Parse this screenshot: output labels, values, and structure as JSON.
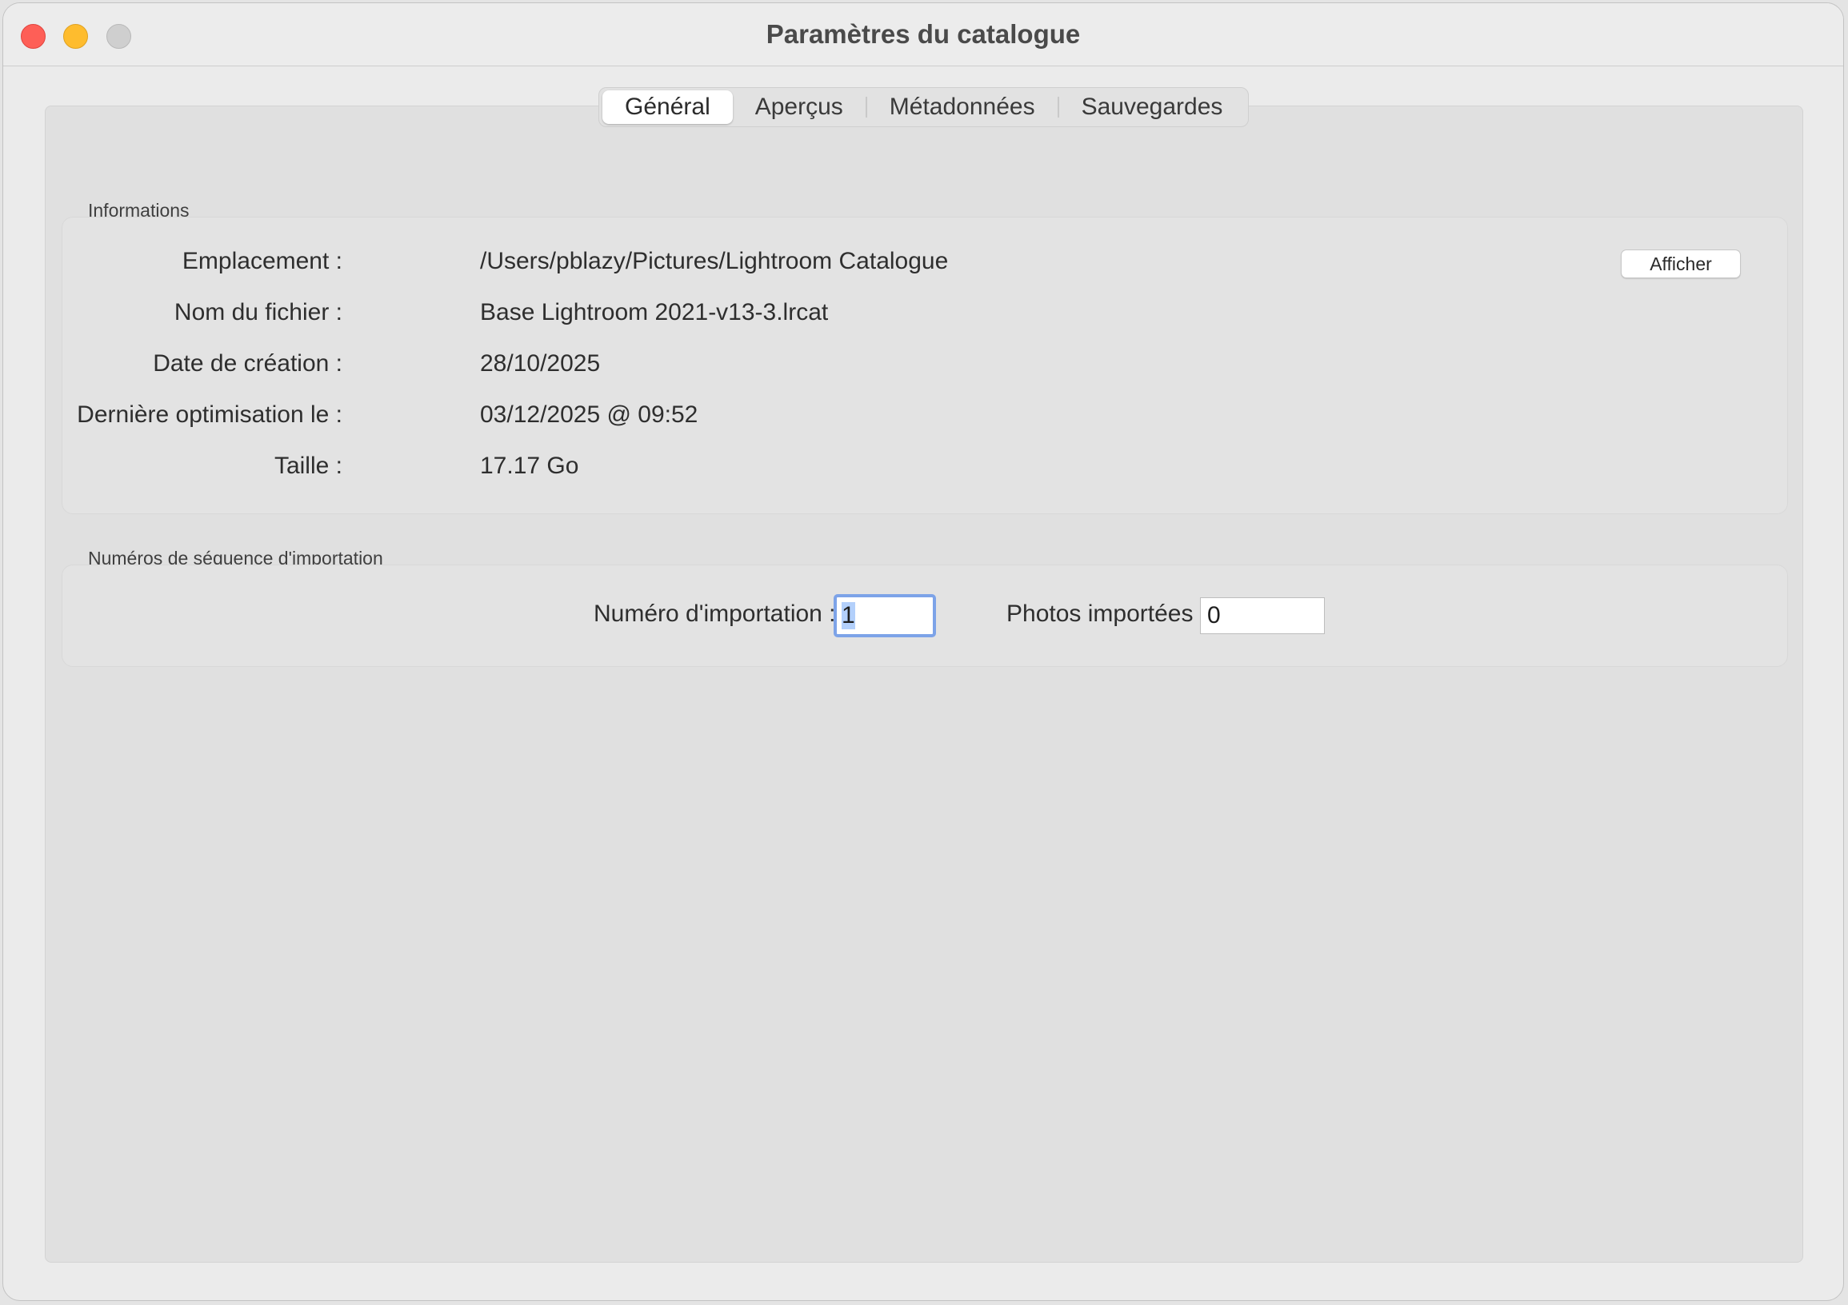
{
  "window": {
    "title": "Paramètres du catalogue"
  },
  "tabs": [
    {
      "label": "Général",
      "active": true
    },
    {
      "label": "Aperçus",
      "active": false
    },
    {
      "label": "Métadonnées",
      "active": false
    },
    {
      "label": "Sauvegardes",
      "active": false
    }
  ],
  "informations": {
    "group_label": "Informations",
    "show_button": "Afficher",
    "rows": [
      {
        "label": "Emplacement :",
        "value": "/Users/pblazy/Pictures/Lightroom Catalogue"
      },
      {
        "label": "Nom du fichier :",
        "value": "Base Lightroom 2021-v13-3.lrcat"
      },
      {
        "label": "Date de création :",
        "value": "28/10/2025"
      },
      {
        "label": "Dernière optimisation le :",
        "value": "03/12/2025 @ 09:52"
      },
      {
        "label": "Taille :",
        "value": "17.17 Go"
      }
    ]
  },
  "import_sequence": {
    "group_label": "Numéros de séquence d'importation",
    "import_number_label": "Numéro d'importation :",
    "import_number_value": "1",
    "photos_imported_label": "Photos importées :",
    "photos_imported_value": "0"
  },
  "colors": {
    "close": "#fe5f57",
    "minimize": "#febc2e",
    "zoom": "#cfcfcf",
    "focus_ring": "#7da3e8"
  }
}
